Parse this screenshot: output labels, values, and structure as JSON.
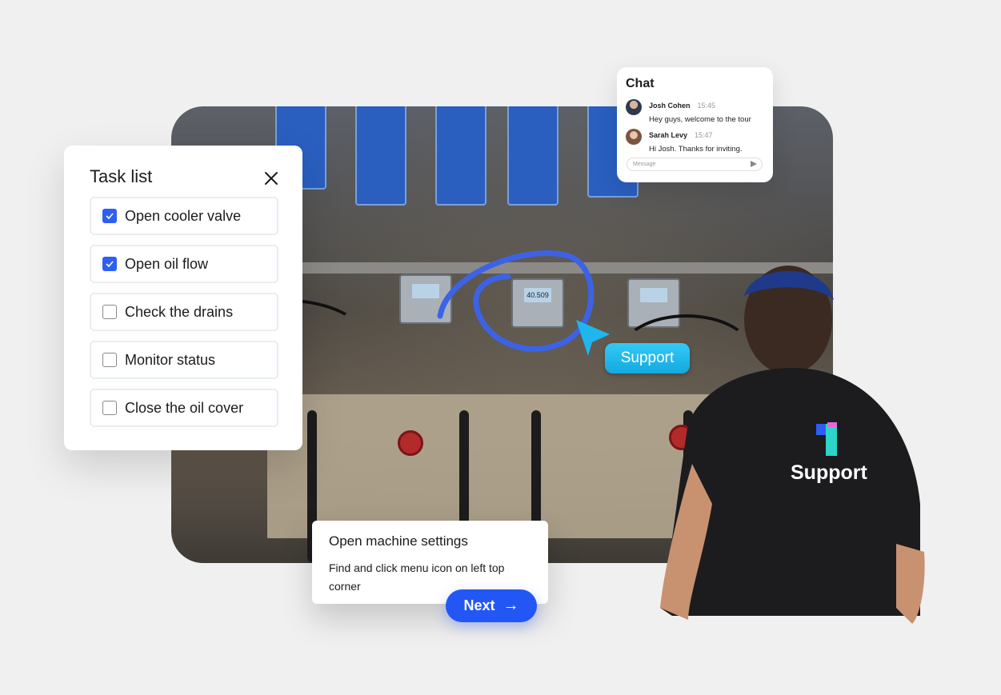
{
  "task_list": {
    "title": "Task list",
    "close_icon": "close-icon",
    "items": [
      {
        "label": "Open cooler valve",
        "checked": true
      },
      {
        "label": "Open oil flow",
        "checked": true
      },
      {
        "label": "Check the drains",
        "checked": false
      },
      {
        "label": "Monitor status",
        "checked": false
      },
      {
        "label": "Close the oil cover",
        "checked": false
      }
    ]
  },
  "chat": {
    "title": "Chat",
    "messages": [
      {
        "name": "Josh Cohen",
        "time": "15:45",
        "text": "Hey guys, welcome to the tour"
      },
      {
        "name": "Sarah Levy",
        "time": "15:47",
        "text": "Hi Josh. Thanks for inviting."
      }
    ],
    "input_placeholder": "Message",
    "send_icon": "send-icon"
  },
  "annotation": {
    "pointer_label": "Support",
    "device_reading": "40.509"
  },
  "step": {
    "title": "Open machine settings",
    "description": "Find and click menu icon on left top corner",
    "next_label": "Next",
    "next_icon": "arrow-right-icon"
  },
  "agent": {
    "shirt_text": "Support"
  },
  "colors": {
    "primary": "#2357f5",
    "checkbox": "#2d5ef5",
    "pointer": "#1fb6ee",
    "annotation_stroke": "#3c63e6"
  }
}
